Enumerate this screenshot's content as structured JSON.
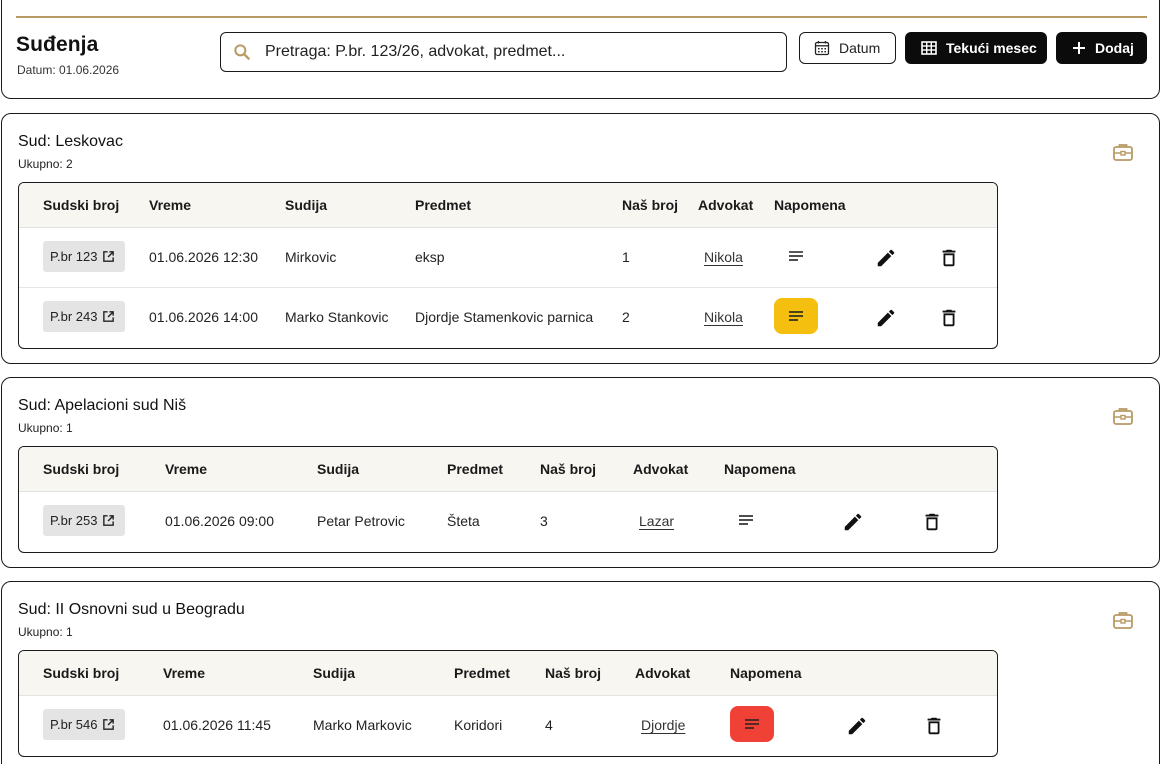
{
  "header": {
    "title": "Suđenja",
    "date": "Datum: 01.06.2026",
    "search_placeholder": "Pretraga: P.br. 123/26, advokat, predmet...",
    "date_button": "Datum",
    "month_button": "Tekući mesec",
    "add_button": "Dodaj"
  },
  "colors": {
    "gold": "#b89a64",
    "note_yellow": "#f5bf0f",
    "note_red": "#ef4135"
  },
  "courts": [
    {
      "title": "Sud: Leskovac",
      "count": "Ukupno: 2",
      "columns": [
        "Sudski broj",
        "Vreme",
        "Sudija",
        "Predmet",
        "Naš broj",
        "Advokat",
        "Napomena"
      ],
      "rows": [
        {
          "case_no": "P.br 123",
          "time": "01.06.2026 12:30",
          "judge": "Mirkovic",
          "subject": "eksp",
          "our_no": "1",
          "lawyer": "Nikola",
          "note": "none"
        },
        {
          "case_no": "P.br 243",
          "time": "01.06.2026 14:00",
          "judge": "Marko Stankovic",
          "subject": "Djordje Stamenkovic parnica",
          "our_no": "2",
          "lawyer": "Nikola",
          "note": "yellow"
        }
      ]
    },
    {
      "title": "Sud: Apelacioni sud Niš",
      "count": "Ukupno: 1",
      "columns": [
        "Sudski broj",
        "Vreme",
        "Sudija",
        "Predmet",
        "Naš broj",
        "Advokat",
        "Napomena"
      ],
      "rows": [
        {
          "case_no": "P.br 253",
          "time": "01.06.2026 09:00",
          "judge": "Petar Petrovic",
          "subject": "Šteta",
          "our_no": "3",
          "lawyer": "Lazar",
          "note": "none"
        }
      ]
    },
    {
      "title": "Sud: II Osnovni sud u Beogradu",
      "count": "Ukupno: 1",
      "columns": [
        "Sudski broj",
        "Vreme",
        "Sudija",
        "Predmet",
        "Naš broj",
        "Advokat",
        "Napomena"
      ],
      "rows": [
        {
          "case_no": "P.br 546",
          "time": "01.06.2026 11:45",
          "judge": "Marko Markovic",
          "subject": "Koridori",
          "our_no": "4",
          "lawyer": "Djordje",
          "note": "red"
        }
      ]
    }
  ],
  "icons": {
    "search": "search-icon",
    "calendar": "calendar-icon",
    "grid": "grid-icon",
    "plus": "plus-icon",
    "briefcase": "briefcase-icon",
    "external": "external-link-icon",
    "note": "notes-icon",
    "edit": "edit-icon",
    "delete": "delete-icon"
  }
}
